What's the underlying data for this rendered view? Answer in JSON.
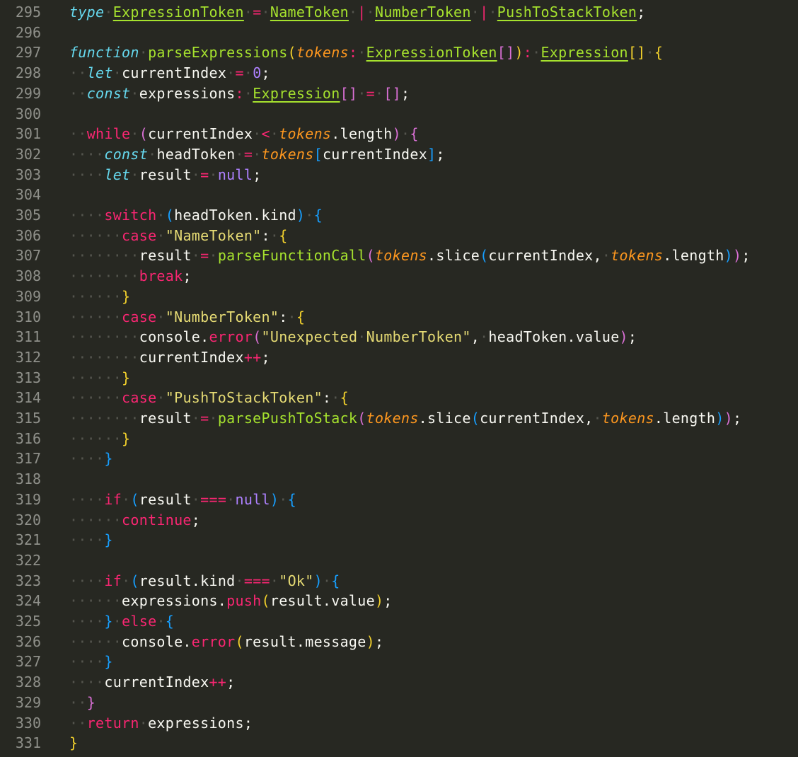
{
  "colors": {
    "background": "#272822",
    "line_number": "#8f908a",
    "whitespace_dot": "#54554e",
    "keyword": "#f92672",
    "storage_keyword": "#66d9ef",
    "function": "#a6e22e",
    "parameter": "#fd971f",
    "string": "#e6db74",
    "number": "#ae81ff",
    "bracket_1": "#f1d02c",
    "bracket_2": "#da70d6",
    "bracket_3": "#179fff"
  },
  "lines": [
    {
      "n": "295",
      "t": [
        [
          "skw",
          "type"
        ],
        [
          "ws",
          "·"
        ],
        [
          "type",
          "ExpressionToken"
        ],
        [
          "ws",
          "·"
        ],
        [
          "op",
          "="
        ],
        [
          "ws",
          "·"
        ],
        [
          "type",
          "NameToken"
        ],
        [
          "ws",
          "·"
        ],
        [
          "op",
          "|"
        ],
        [
          "ws",
          "·"
        ],
        [
          "type",
          "NumberToken"
        ],
        [
          "ws",
          "·"
        ],
        [
          "op",
          "|"
        ],
        [
          "ws",
          "·"
        ],
        [
          "type",
          "PushToStackToken"
        ],
        [
          "punct",
          ";"
        ]
      ]
    },
    {
      "n": "296",
      "t": []
    },
    {
      "n": "297",
      "t": [
        [
          "skw",
          "function"
        ],
        [
          "ws",
          "·"
        ],
        [
          "fn",
          "parseExpressions"
        ],
        [
          "br1",
          "("
        ],
        [
          "param",
          "tokens"
        ],
        [
          "op",
          ":"
        ],
        [
          "ws",
          "·"
        ],
        [
          "type",
          "ExpressionToken"
        ],
        [
          "br2",
          "[]"
        ],
        [
          "br1",
          ")"
        ],
        [
          "op",
          ":"
        ],
        [
          "ws",
          "·"
        ],
        [
          "type",
          "Expression"
        ],
        [
          "br1",
          "[]"
        ],
        [
          "ws",
          "·"
        ],
        [
          "br1",
          "{"
        ]
      ]
    },
    {
      "n": "298",
      "t": [
        [
          "ws",
          "··"
        ],
        [
          "skw",
          "let"
        ],
        [
          "ws",
          "·"
        ],
        [
          "plain",
          "currentIndex"
        ],
        [
          "ws",
          "·"
        ],
        [
          "op",
          "="
        ],
        [
          "ws",
          "·"
        ],
        [
          "num",
          "0"
        ],
        [
          "punct",
          ";"
        ]
      ]
    },
    {
      "n": "299",
      "t": [
        [
          "ws",
          "··"
        ],
        [
          "skw",
          "const"
        ],
        [
          "ws",
          "·"
        ],
        [
          "plain",
          "expressions"
        ],
        [
          "op",
          ":"
        ],
        [
          "ws",
          "·"
        ],
        [
          "type",
          "Expression"
        ],
        [
          "br2",
          "[]"
        ],
        [
          "ws",
          "·"
        ],
        [
          "op",
          "="
        ],
        [
          "ws",
          "·"
        ],
        [
          "br2",
          "[]"
        ],
        [
          "punct",
          ";"
        ]
      ]
    },
    {
      "n": "300",
      "t": []
    },
    {
      "n": "301",
      "t": [
        [
          "ws",
          "··"
        ],
        [
          "kw",
          "while"
        ],
        [
          "ws",
          "·"
        ],
        [
          "br2",
          "("
        ],
        [
          "plain",
          "currentIndex"
        ],
        [
          "ws",
          "·"
        ],
        [
          "op",
          "<"
        ],
        [
          "ws",
          "·"
        ],
        [
          "param",
          "tokens"
        ],
        [
          "plain",
          ".length"
        ],
        [
          "br2",
          ")"
        ],
        [
          "ws",
          "·"
        ],
        [
          "br2",
          "{"
        ]
      ]
    },
    {
      "n": "302",
      "t": [
        [
          "ws",
          "····"
        ],
        [
          "skw",
          "const"
        ],
        [
          "ws",
          "·"
        ],
        [
          "plain",
          "headToken"
        ],
        [
          "ws",
          "·"
        ],
        [
          "op",
          "="
        ],
        [
          "ws",
          "·"
        ],
        [
          "param",
          "tokens"
        ],
        [
          "br3",
          "["
        ],
        [
          "plain",
          "currentIndex"
        ],
        [
          "br3",
          "]"
        ],
        [
          "punct",
          ";"
        ]
      ]
    },
    {
      "n": "303",
      "t": [
        [
          "ws",
          "····"
        ],
        [
          "skw",
          "let"
        ],
        [
          "ws",
          "·"
        ],
        [
          "plain",
          "result"
        ],
        [
          "ws",
          "·"
        ],
        [
          "op",
          "="
        ],
        [
          "ws",
          "·"
        ],
        [
          "num",
          "null"
        ],
        [
          "punct",
          ";"
        ]
      ]
    },
    {
      "n": "304",
      "t": []
    },
    {
      "n": "305",
      "t": [
        [
          "ws",
          "····"
        ],
        [
          "kw",
          "switch"
        ],
        [
          "ws",
          "·"
        ],
        [
          "br3",
          "("
        ],
        [
          "plain",
          "headToken.kind"
        ],
        [
          "br3",
          ")"
        ],
        [
          "ws",
          "·"
        ],
        [
          "br3",
          "{"
        ]
      ]
    },
    {
      "n": "306",
      "t": [
        [
          "ws",
          "······"
        ],
        [
          "kw",
          "case"
        ],
        [
          "ws",
          "·"
        ],
        [
          "str",
          "\"NameToken\""
        ],
        [
          "punct",
          ":"
        ],
        [
          "ws",
          "·"
        ],
        [
          "br1",
          "{"
        ]
      ]
    },
    {
      "n": "307",
      "t": [
        [
          "ws",
          "········"
        ],
        [
          "plain",
          "result"
        ],
        [
          "ws",
          "·"
        ],
        [
          "op",
          "="
        ],
        [
          "ws",
          "·"
        ],
        [
          "fcall",
          "parseFunctionCall"
        ],
        [
          "br2",
          "("
        ],
        [
          "param",
          "tokens"
        ],
        [
          "plain",
          ".slice"
        ],
        [
          "br3",
          "("
        ],
        [
          "plain",
          "currentIndex,"
        ],
        [
          "ws",
          "·"
        ],
        [
          "param",
          "tokens"
        ],
        [
          "plain",
          ".length"
        ],
        [
          "br3",
          ")"
        ],
        [
          "br2",
          ")"
        ],
        [
          "punct",
          ";"
        ]
      ]
    },
    {
      "n": "308",
      "t": [
        [
          "ws",
          "········"
        ],
        [
          "kw",
          "break"
        ],
        [
          "punct",
          ";"
        ]
      ]
    },
    {
      "n": "309",
      "t": [
        [
          "ws",
          "······"
        ],
        [
          "br1",
          "}"
        ]
      ]
    },
    {
      "n": "310",
      "t": [
        [
          "ws",
          "······"
        ],
        [
          "kw",
          "case"
        ],
        [
          "ws",
          "·"
        ],
        [
          "str",
          "\"NumberToken\""
        ],
        [
          "punct",
          ":"
        ],
        [
          "ws",
          "·"
        ],
        [
          "br1",
          "{"
        ]
      ]
    },
    {
      "n": "311",
      "t": [
        [
          "ws",
          "········"
        ],
        [
          "plain",
          "console."
        ],
        [
          "fcall2",
          "error"
        ],
        [
          "br2",
          "("
        ],
        [
          "str",
          "\"Unexpected"
        ],
        [
          "ws",
          "·"
        ],
        [
          "str",
          "NumberToken\""
        ],
        [
          "plain",
          ","
        ],
        [
          "ws",
          "·"
        ],
        [
          "plain",
          "headToken.value"
        ],
        [
          "br2",
          ")"
        ],
        [
          "punct",
          ";"
        ]
      ]
    },
    {
      "n": "312",
      "t": [
        [
          "ws",
          "········"
        ],
        [
          "plain",
          "currentIndex"
        ],
        [
          "op",
          "++"
        ],
        [
          "punct",
          ";"
        ]
      ]
    },
    {
      "n": "313",
      "t": [
        [
          "ws",
          "······"
        ],
        [
          "br1",
          "}"
        ]
      ]
    },
    {
      "n": "314",
      "t": [
        [
          "ws",
          "······"
        ],
        [
          "kw",
          "case"
        ],
        [
          "ws",
          "·"
        ],
        [
          "str",
          "\"PushToStackToken\""
        ],
        [
          "punct",
          ":"
        ],
        [
          "ws",
          "·"
        ],
        [
          "br1",
          "{"
        ]
      ]
    },
    {
      "n": "315",
      "t": [
        [
          "ws",
          "········"
        ],
        [
          "plain",
          "result"
        ],
        [
          "ws",
          "·"
        ],
        [
          "op",
          "="
        ],
        [
          "ws",
          "·"
        ],
        [
          "fcall",
          "parsePushToStack"
        ],
        [
          "br2",
          "("
        ],
        [
          "param",
          "tokens"
        ],
        [
          "plain",
          ".slice"
        ],
        [
          "br3",
          "("
        ],
        [
          "plain",
          "currentIndex,"
        ],
        [
          "ws",
          "·"
        ],
        [
          "param",
          "tokens"
        ],
        [
          "plain",
          ".length"
        ],
        [
          "br3",
          ")"
        ],
        [
          "br2",
          ")"
        ],
        [
          "punct",
          ";"
        ]
      ]
    },
    {
      "n": "316",
      "t": [
        [
          "ws",
          "······"
        ],
        [
          "br1",
          "}"
        ]
      ]
    },
    {
      "n": "317",
      "t": [
        [
          "ws",
          "····"
        ],
        [
          "br3",
          "}"
        ]
      ]
    },
    {
      "n": "318",
      "t": []
    },
    {
      "n": "319",
      "t": [
        [
          "ws",
          "····"
        ],
        [
          "kw",
          "if"
        ],
        [
          "ws",
          "·"
        ],
        [
          "br3",
          "("
        ],
        [
          "plain",
          "result"
        ],
        [
          "ws",
          "·"
        ],
        [
          "op",
          "==="
        ],
        [
          "ws",
          "·"
        ],
        [
          "num",
          "null"
        ],
        [
          "br3",
          ")"
        ],
        [
          "ws",
          "·"
        ],
        [
          "br3",
          "{"
        ]
      ]
    },
    {
      "n": "320",
      "t": [
        [
          "ws",
          "······"
        ],
        [
          "kw",
          "continue"
        ],
        [
          "punct",
          ";"
        ]
      ]
    },
    {
      "n": "321",
      "t": [
        [
          "ws",
          "····"
        ],
        [
          "br3",
          "}"
        ]
      ]
    },
    {
      "n": "322",
      "t": []
    },
    {
      "n": "323",
      "t": [
        [
          "ws",
          "····"
        ],
        [
          "kw",
          "if"
        ],
        [
          "ws",
          "·"
        ],
        [
          "br3",
          "("
        ],
        [
          "plain",
          "result.kind"
        ],
        [
          "ws",
          "·"
        ],
        [
          "op",
          "==="
        ],
        [
          "ws",
          "·"
        ],
        [
          "str",
          "\"Ok\""
        ],
        [
          "br3",
          ")"
        ],
        [
          "ws",
          "·"
        ],
        [
          "br3",
          "{"
        ]
      ]
    },
    {
      "n": "324",
      "t": [
        [
          "ws",
          "······"
        ],
        [
          "plain",
          "expressions."
        ],
        [
          "fcall2",
          "push"
        ],
        [
          "br1",
          "("
        ],
        [
          "plain",
          "result.value"
        ],
        [
          "br1",
          ")"
        ],
        [
          "punct",
          ";"
        ]
      ]
    },
    {
      "n": "325",
      "t": [
        [
          "ws",
          "····"
        ],
        [
          "br3",
          "}"
        ],
        [
          "ws",
          "·"
        ],
        [
          "kw",
          "else"
        ],
        [
          "ws",
          "·"
        ],
        [
          "br3",
          "{"
        ]
      ]
    },
    {
      "n": "326",
      "t": [
        [
          "ws",
          "······"
        ],
        [
          "plain",
          "console."
        ],
        [
          "fcall2",
          "error"
        ],
        [
          "br1",
          "("
        ],
        [
          "plain",
          "result.message"
        ],
        [
          "br1",
          ")"
        ],
        [
          "punct",
          ";"
        ]
      ]
    },
    {
      "n": "327",
      "t": [
        [
          "ws",
          "····"
        ],
        [
          "br3",
          "}"
        ]
      ]
    },
    {
      "n": "328",
      "t": [
        [
          "ws",
          "····"
        ],
        [
          "plain",
          "currentIndex"
        ],
        [
          "op",
          "++"
        ],
        [
          "punct",
          ";"
        ]
      ]
    },
    {
      "n": "329",
      "t": [
        [
          "ws",
          "··"
        ],
        [
          "br2",
          "}"
        ]
      ]
    },
    {
      "n": "330",
      "t": [
        [
          "ws",
          "··"
        ],
        [
          "kw",
          "return"
        ],
        [
          "ws",
          "·"
        ],
        [
          "plain",
          "expressions"
        ],
        [
          "punct",
          ";"
        ]
      ]
    },
    {
      "n": "331",
      "t": [
        [
          "br1",
          "}"
        ]
      ]
    }
  ]
}
